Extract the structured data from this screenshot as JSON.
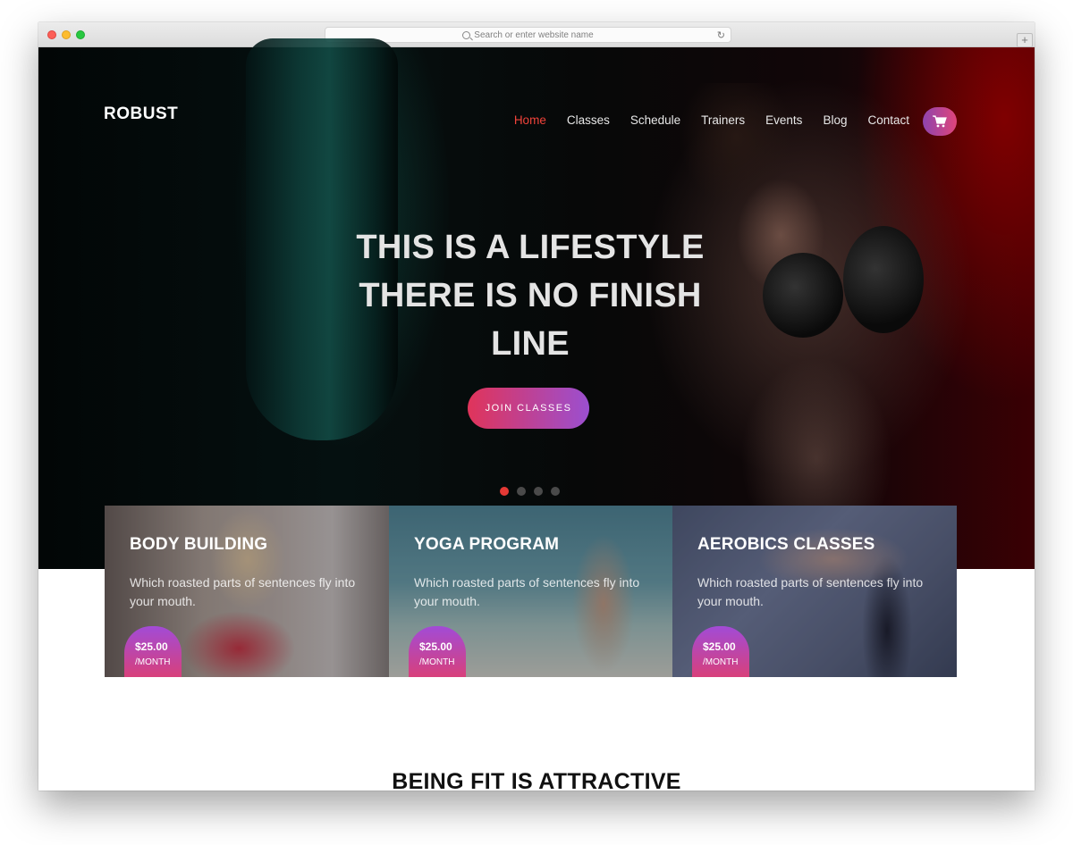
{
  "browser": {
    "url_placeholder": "Search or enter website name",
    "new_tab": "+"
  },
  "site": {
    "logo": "ROBUST",
    "nav": [
      {
        "label": "Home",
        "active": true
      },
      {
        "label": "Classes"
      },
      {
        "label": "Schedule"
      },
      {
        "label": "Trainers"
      },
      {
        "label": "Events"
      },
      {
        "label": "Blog"
      },
      {
        "label": "Contact"
      }
    ],
    "cart_icon": "cart-icon",
    "accent": "#f0433a"
  },
  "hero": {
    "headline_line1": "THIS IS A LIFESTYLE",
    "headline_line2": "THERE IS NO FINISH",
    "headline_line3": "LINE",
    "cta": "JOIN CLASSES",
    "slides": 4,
    "active_slide": 1
  },
  "programs": [
    {
      "title": "BODY BUILDING",
      "text": "Which roasted parts of sentences fly into your mouth.",
      "price": "$25.00",
      "period": "/MONTH"
    },
    {
      "title": "YOGA PROGRAM",
      "text": "Which roasted parts of sentences fly into your mouth.",
      "price": "$25.00",
      "period": "/MONTH"
    },
    {
      "title": "AEROBICS CLASSES",
      "text": "Which roasted parts of sentences fly into your mouth.",
      "price": "$25.00",
      "period": "/MONTH"
    }
  ],
  "section": {
    "title": "BEING FIT IS ATTRACTIVE"
  }
}
